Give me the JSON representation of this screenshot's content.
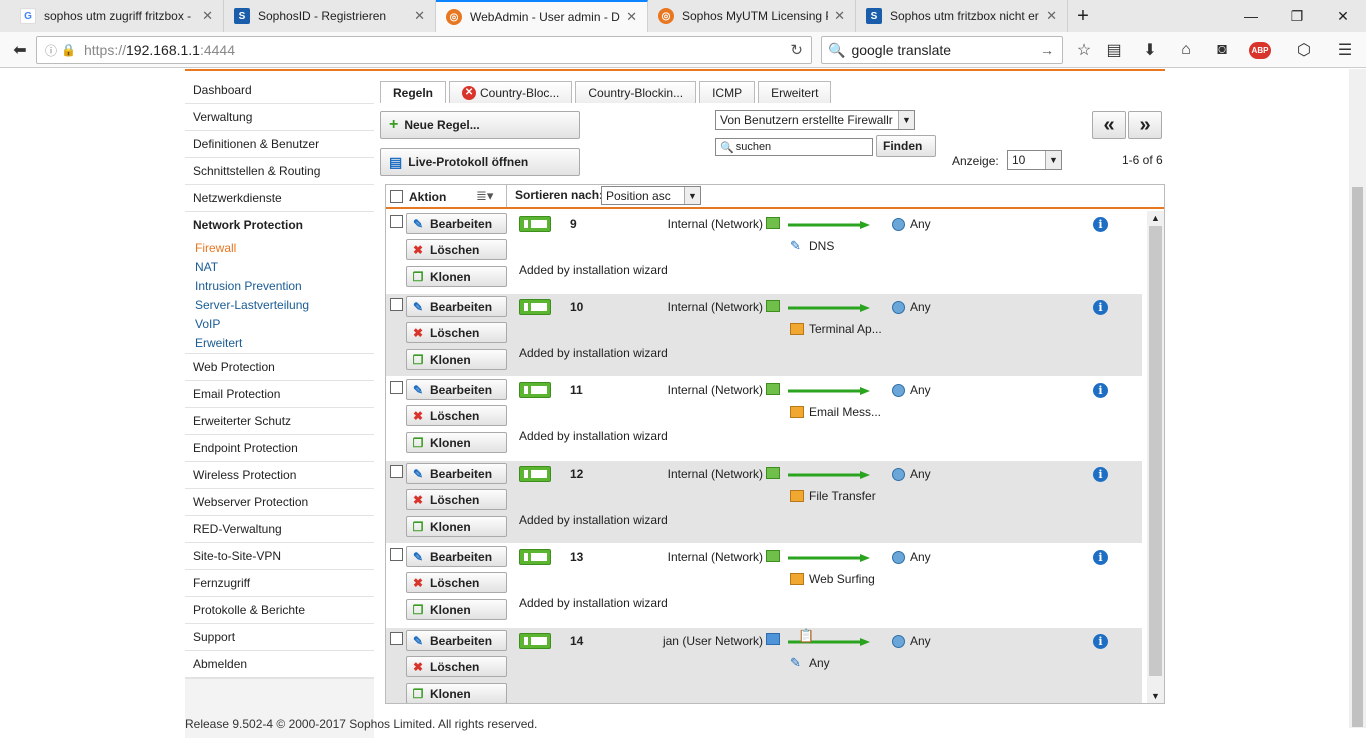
{
  "browser": {
    "tabs": [
      {
        "title": "sophos utm zugriff fritzbox -",
        "icon": "google-icon",
        "active": false
      },
      {
        "title": "SophosID - Registrieren",
        "icon": "sophos-icon",
        "active": false
      },
      {
        "title": "WebAdmin - User admin - D",
        "icon": "firefox-icon",
        "active": true
      },
      {
        "title": "Sophos MyUTM Licensing P",
        "icon": "firefox-icon",
        "active": false
      },
      {
        "title": "Sophos utm fritzbox nicht er",
        "icon": "sophos-icon",
        "active": false
      }
    ],
    "new_tab": "+",
    "url_proto": "https://",
    "url_host": "192.168.1.1",
    "url_port": ":4444",
    "search_value": "google translate"
  },
  "sidebar": {
    "items_top": [
      "Dashboard",
      "Verwaltung",
      "Definitionen & Benutzer",
      "Schnittstellen & Routing",
      "Netzwerkdienste"
    ],
    "section": "Network Protection",
    "sub_items": [
      "Firewall",
      "NAT",
      "Intrusion Prevention",
      "Server-Lastverteilung",
      "VoIP",
      "Erweitert"
    ],
    "items_bottom": [
      "Web Protection",
      "Email Protection",
      "Erweiterter Schutz",
      "Endpoint Protection",
      "Wireless Protection",
      "Webserver Protection",
      "RED-Verwaltung",
      "Site-to-Site-VPN",
      "Fernzugriff",
      "Protokolle & Berichte",
      "Support",
      "Abmelden"
    ]
  },
  "content": {
    "tabs": [
      "Regeln",
      "Country-Bloc...",
      "Country-Blockin...",
      "ICMP",
      "Erweitert"
    ],
    "new_rule": "Neue Regel...",
    "live_log": "Live-Protokoll öffnen",
    "filter_select": "Von Benutzern erstellte Firewallr",
    "search_placeholder": "suchen",
    "find": "Finden",
    "show_label": "Anzeige:",
    "show_value": "10",
    "range": "1-6 of 6",
    "prev": "«",
    "next": "»",
    "col_action": "Aktion",
    "sort_label": "Sortieren nach:",
    "sort_value": "Position asc",
    "btn_edit": "Bearbeiten",
    "btn_delete": "Löschen",
    "btn_clone": "Klonen"
  },
  "rules": [
    {
      "num": "9",
      "source": "Internal (Network)",
      "src_type": "network",
      "service": "DNS",
      "svc_type": "tool",
      "dest": "Any",
      "comment": "Added by installation wizard"
    },
    {
      "num": "10",
      "source": "Internal (Network)",
      "src_type": "network",
      "service": "Terminal Ap...",
      "svc_type": "folder",
      "dest": "Any",
      "comment": "Added by installation wizard"
    },
    {
      "num": "11",
      "source": "Internal (Network)",
      "src_type": "network",
      "service": "Email Mess...",
      "svc_type": "folder",
      "dest": "Any",
      "comment": "Added by installation wizard"
    },
    {
      "num": "12",
      "source": "Internal (Network)",
      "src_type": "network",
      "service": "File Transfer",
      "svc_type": "folder",
      "dest": "Any",
      "comment": "Added by installation wizard"
    },
    {
      "num": "13",
      "source": "Internal (Network)",
      "src_type": "network",
      "service": "Web Surfing",
      "svc_type": "folder",
      "dest": "Any",
      "comment": "Added by installation wizard"
    },
    {
      "num": "14",
      "source": "jan (User Network)",
      "src_type": "user",
      "service": "Any",
      "svc_type": "tool",
      "dest": "Any",
      "comment": ""
    }
  ],
  "footer": "Release 9.502-4 © 2000-2017 Sophos Limited. All rights reserved.",
  "colors": {
    "accent": "#e87722",
    "link": "#1a5b94",
    "toggle": "#5cb531"
  }
}
